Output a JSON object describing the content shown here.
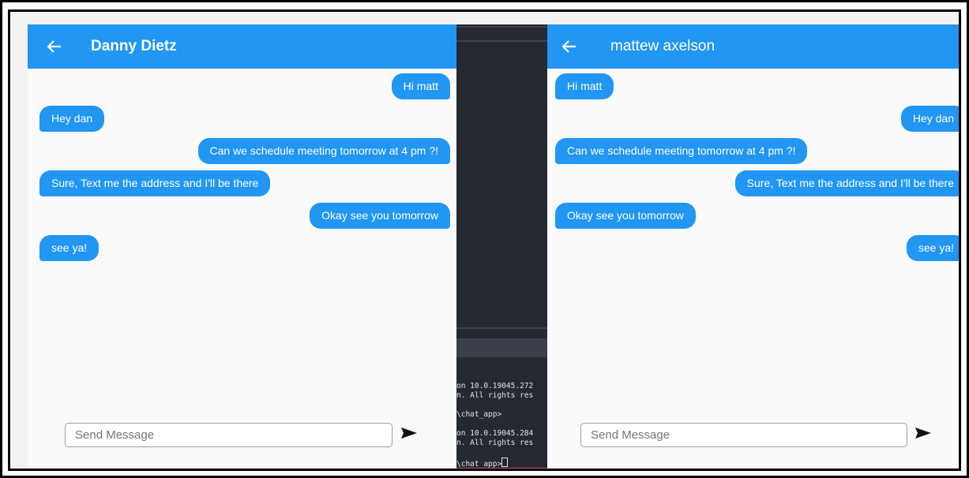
{
  "left_chat": {
    "title": "Danny Dietz",
    "messages": [
      {
        "text": "Hi matt",
        "side": "right"
      },
      {
        "text": "Hey dan",
        "side": "left"
      },
      {
        "text": "Can we schedule meeting tomorrow at 4 pm ?!",
        "side": "right"
      },
      {
        "text": "Sure, Text me the address and I'll be there",
        "side": "left"
      },
      {
        "text": "Okay see you tomorrow",
        "side": "right"
      },
      {
        "text": "see ya!",
        "side": "left"
      }
    ],
    "input_placeholder": "Send Message"
  },
  "right_chat": {
    "title": "mattew axelson",
    "messages": [
      {
        "text": "Hi matt",
        "side": "left"
      },
      {
        "text": "Hey dan",
        "side": "right"
      },
      {
        "text": "Can we schedule meeting tomorrow at 4 pm ?!",
        "side": "left"
      },
      {
        "text": "Sure, Text me the address and I'll be there",
        "side": "right"
      },
      {
        "text": "Okay see you tomorrow",
        "side": "left"
      },
      {
        "text": "see ya!",
        "side": "right"
      }
    ],
    "input_placeholder": "Send Message"
  },
  "terminal": {
    "lines": [
      "on 10.0.19045.272",
      "n. All rights res",
      "",
      "\\chat_app>",
      "",
      "on 10.0.19045.284",
      "n. All rights res",
      "",
      "\\chat_app>"
    ]
  },
  "colors": {
    "accent": "#2196f3",
    "background": "#fafafa",
    "terminal_bg": "#252932"
  },
  "icons": {
    "back": "arrow-back",
    "send": "send-arrow"
  }
}
